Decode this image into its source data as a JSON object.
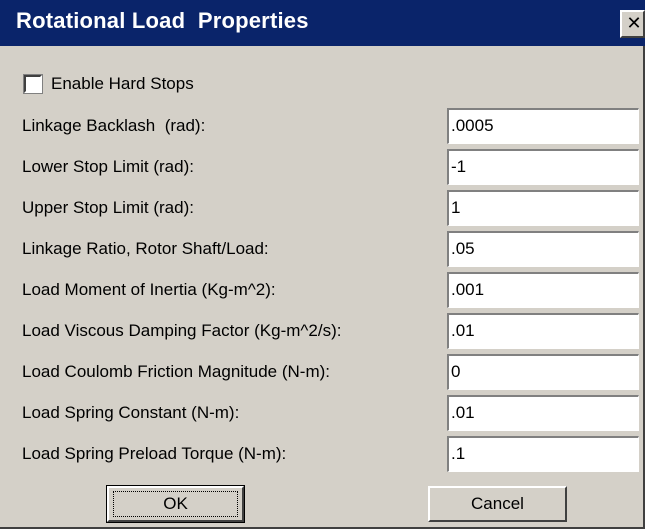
{
  "window": {
    "title": "Rotational Load  Properties",
    "close_glyph": "✕"
  },
  "hard_stops": {
    "label": "Enable Hard Stops",
    "checked": false
  },
  "fields": [
    {
      "label": "Linkage Backlash  (rad):",
      "value": ".0005"
    },
    {
      "label": "Lower Stop Limit (rad):",
      "value": "-1"
    },
    {
      "label": "Upper Stop Limit (rad):",
      "value": "1"
    },
    {
      "label": "Linkage Ratio, Rotor Shaft/Load:",
      "value": ".05"
    },
    {
      "label": "Load Moment of Inertia (Kg-m^2):",
      "value": ".001"
    },
    {
      "label": "Load Viscous Damping Factor (Kg-m^2/s):",
      "value": ".01"
    },
    {
      "label": "Load Coulomb Friction Magnitude (N-m):",
      "value": "0"
    },
    {
      "label": "Load Spring Constant (N-m):",
      "value": ".01"
    },
    {
      "label": "Load Spring Preload Torque (N-m):",
      "value": ".1"
    }
  ],
  "buttons": {
    "ok_label": "OK",
    "cancel_label": "Cancel"
  },
  "colors": {
    "titlebar": "#0a246a",
    "face": "#d4d0c8"
  }
}
